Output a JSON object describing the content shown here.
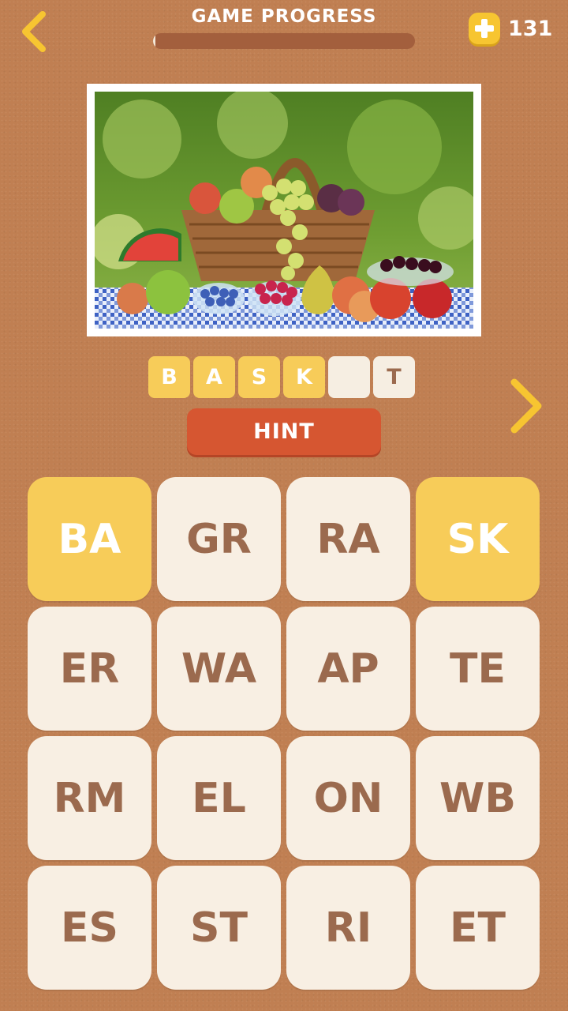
{
  "header": {
    "title": "GAME PROGRESS",
    "progress_fraction": 0.01,
    "coins": "131"
  },
  "answer": [
    {
      "letter": "B",
      "state": "filled"
    },
    {
      "letter": "A",
      "state": "filled"
    },
    {
      "letter": "S",
      "state": "filled"
    },
    {
      "letter": "K",
      "state": "filled"
    },
    {
      "letter": "",
      "state": "empty"
    },
    {
      "letter": "T",
      "state": "empty"
    }
  ],
  "hint_label": "HINT",
  "tiles": [
    {
      "text": "BA",
      "selected": true
    },
    {
      "text": "GR",
      "selected": false
    },
    {
      "text": "RA",
      "selected": false
    },
    {
      "text": "SK",
      "selected": true
    },
    {
      "text": "ER",
      "selected": false
    },
    {
      "text": "WA",
      "selected": false
    },
    {
      "text": "AP",
      "selected": false
    },
    {
      "text": "TE",
      "selected": false
    },
    {
      "text": "RM",
      "selected": false
    },
    {
      "text": "EL",
      "selected": false
    },
    {
      "text": "ON",
      "selected": false
    },
    {
      "text": "WB",
      "selected": false
    },
    {
      "text": "ES",
      "selected": false
    },
    {
      "text": "ST",
      "selected": false
    },
    {
      "text": "RI",
      "selected": false
    },
    {
      "text": "ET",
      "selected": false
    }
  ],
  "colors": {
    "background": "#c07f52",
    "accent_yellow": "#f7cc59",
    "hint_red": "#d65631",
    "tile_cream": "#f8efe3",
    "tile_text": "#9b6a4e"
  },
  "icons": {
    "back": "chevron-left-icon",
    "next": "chevron-right-icon",
    "coin_add": "plus-icon"
  }
}
